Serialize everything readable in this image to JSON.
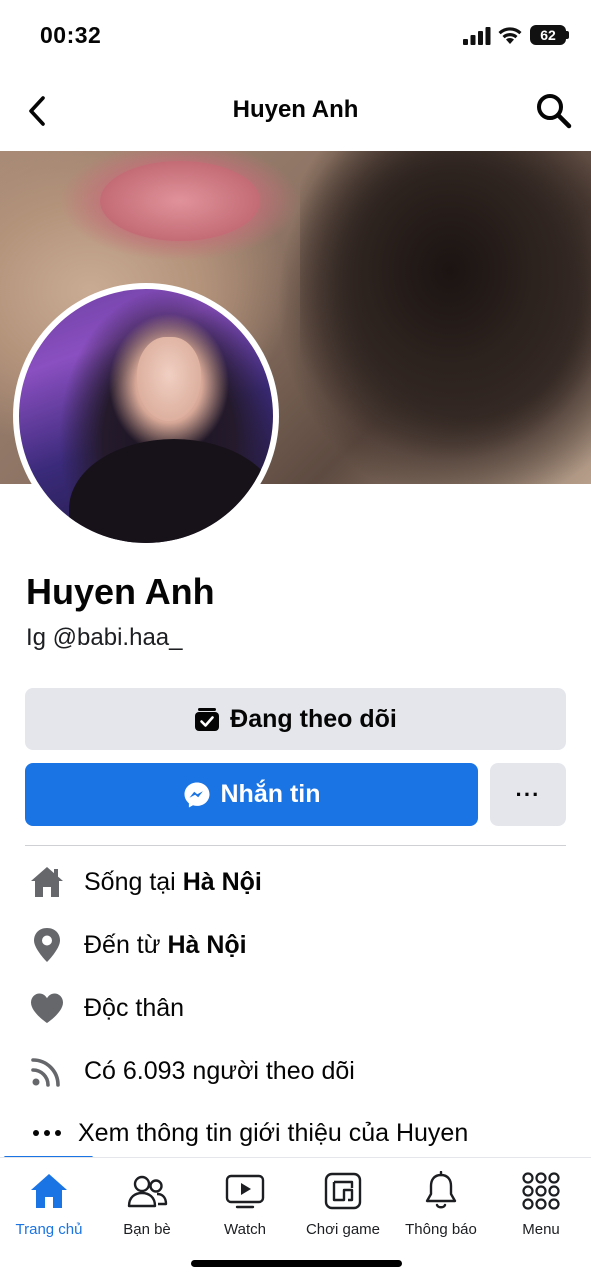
{
  "status_bar": {
    "time": "00:32",
    "battery": "62"
  },
  "header": {
    "title": "Huyen Anh"
  },
  "profile": {
    "name": "Huyen Anh",
    "bio": "Ig @babi.haa_"
  },
  "actions": {
    "following_label": "Đang theo dõi",
    "message_label": "Nhắn tin",
    "more_label": "···"
  },
  "details": {
    "lives_prefix": "Sống tại ",
    "lives_city": "Hà Nội",
    "from_prefix": "Đến từ ",
    "from_city": "Hà Nội",
    "relationship": "Độc thân",
    "followers": "Có 6.093 người theo dõi",
    "see_more": "Xem thông tin giới thiệu của Huyen"
  },
  "tabs": [
    {
      "label": "Trang chủ",
      "icon": "home-icon",
      "active": true
    },
    {
      "label": "Bạn bè",
      "icon": "friends-icon",
      "active": false
    },
    {
      "label": "Watch",
      "icon": "watch-icon",
      "active": false
    },
    {
      "label": "Chơi game",
      "icon": "gaming-icon",
      "active": false
    },
    {
      "label": "Thông báo",
      "icon": "bell-icon",
      "active": false
    },
    {
      "label": "Menu",
      "icon": "grid-icon",
      "active": false
    }
  ],
  "colors": {
    "accent": "#1b74e4",
    "button_gray": "#e4e6eb",
    "icon_gray": "#65676b"
  }
}
